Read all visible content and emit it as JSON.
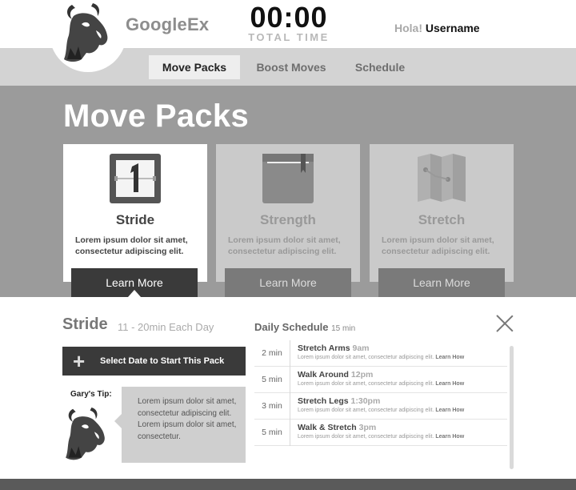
{
  "header": {
    "brand": "GoogleEx",
    "timer": "00:00",
    "timer_label": "TOTAL TIME",
    "greeting": "Hola!",
    "username": "Username"
  },
  "nav": {
    "tabs": [
      {
        "label": "Move Packs",
        "active": true
      },
      {
        "label": "Boost Moves",
        "active": false
      },
      {
        "label": "Schedule",
        "active": false
      }
    ]
  },
  "main": {
    "title": "Move Packs",
    "cards": [
      {
        "title": "Stride",
        "description": "Lorem ipsum dolor sit amet, consectetur adipiscing elit.",
        "button": "Learn More",
        "icon": "calendar-icon",
        "active": true
      },
      {
        "title": "Strength",
        "description": "Lorem ipsum dolor sit amet, consectetur adipiscing elit.",
        "button": "Learn More",
        "icon": "book-icon",
        "active": false
      },
      {
        "title": "Stretch",
        "description": "Lorem ipsum dolor sit amet, consectetur adipiscing elit.",
        "button": "Learn More",
        "icon": "map-icon",
        "active": false
      }
    ]
  },
  "detail": {
    "pack_name": "Stride",
    "duration": "11 - 20min Each Day",
    "select_button": "Select Date to Start This Pack",
    "tip_label": "Gary's Tip:",
    "tip_text": "Lorem ipsum dolor sit amet, consectetur adipiscing elit. Lorem ipsum dolor sit amet, consectetur.",
    "schedule_title": "Daily Schedule",
    "schedule_minutes": "15 min",
    "schedule": [
      {
        "duration": "2 min",
        "name": "Stretch Arms",
        "time": "9am",
        "text": "Lorem ipsum dolor sit amet, consectetur adipiscing elit.",
        "link": "Learn How"
      },
      {
        "duration": "5 min",
        "name": "Walk Around",
        "time": "12pm",
        "text": "Lorem ipsum dolor sit amet, consectetur adipiscing elit.",
        "link": "Learn How"
      },
      {
        "duration": "3 min",
        "name": "Stretch Legs",
        "time": "1:30pm",
        "text": "Lorem ipsum dolor sit amet, consectetur adipiscing elit.",
        "link": "Learn How"
      },
      {
        "duration": "5 min",
        "name": "Walk & Stretch",
        "time": "3pm",
        "text": "Lorem ipsum dolor sit amet, consectetur adipiscing elit.",
        "link": "Learn How"
      }
    ]
  },
  "colors": {
    "hero_bg": "#9b9b9b",
    "nav_bg": "#d3d3d3",
    "dark_button": "#3a3a3a"
  }
}
